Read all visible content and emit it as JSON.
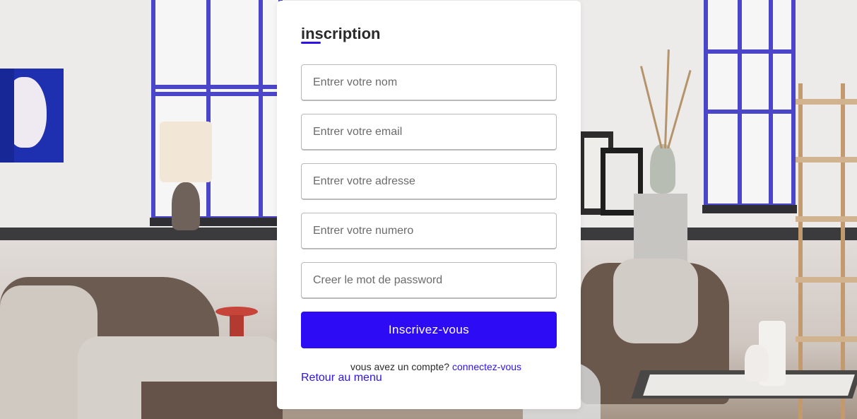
{
  "signup": {
    "title": "inscription",
    "fields": [
      {
        "placeholder": "Entrer votre nom",
        "value": ""
      },
      {
        "placeholder": "Entrer votre email",
        "value": ""
      },
      {
        "placeholder": "Entrer votre adresse",
        "value": ""
      },
      {
        "placeholder": "Entrer votre numero",
        "value": ""
      },
      {
        "placeholder": "Creer le mot de password",
        "value": ""
      }
    ],
    "submit_label": "Inscrivez-vous",
    "have_account_text": "vous avez un compte?",
    "login_link": "connectez-vous",
    "back_link": "Retour au menu"
  },
  "colors": {
    "accent": "#2e0bf5",
    "card_bg": "#ffffff",
    "title_text": "#2a2a2a",
    "link": "#2e13e6"
  }
}
